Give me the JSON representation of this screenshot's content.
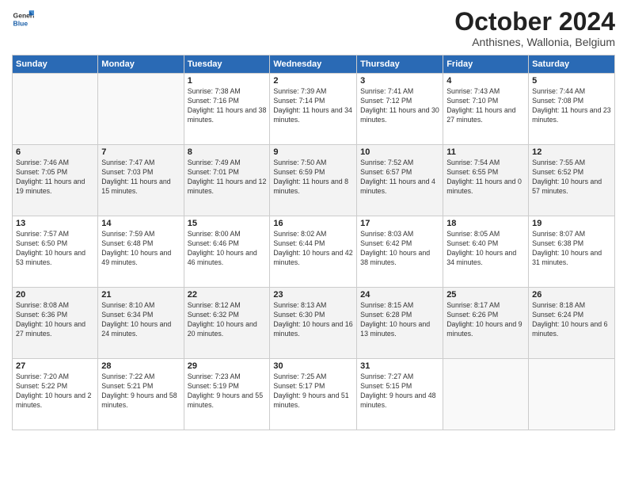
{
  "header": {
    "logo_general": "General",
    "logo_blue": "Blue",
    "month_title": "October 2024",
    "location": "Anthisnes, Wallonia, Belgium"
  },
  "days_of_week": [
    "Sunday",
    "Monday",
    "Tuesday",
    "Wednesday",
    "Thursday",
    "Friday",
    "Saturday"
  ],
  "weeks": [
    [
      {
        "day": "",
        "info": ""
      },
      {
        "day": "",
        "info": ""
      },
      {
        "day": "1",
        "info": "Sunrise: 7:38 AM\nSunset: 7:16 PM\nDaylight: 11 hours and 38 minutes."
      },
      {
        "day": "2",
        "info": "Sunrise: 7:39 AM\nSunset: 7:14 PM\nDaylight: 11 hours and 34 minutes."
      },
      {
        "day": "3",
        "info": "Sunrise: 7:41 AM\nSunset: 7:12 PM\nDaylight: 11 hours and 30 minutes."
      },
      {
        "day": "4",
        "info": "Sunrise: 7:43 AM\nSunset: 7:10 PM\nDaylight: 11 hours and 27 minutes."
      },
      {
        "day": "5",
        "info": "Sunrise: 7:44 AM\nSunset: 7:08 PM\nDaylight: 11 hours and 23 minutes."
      }
    ],
    [
      {
        "day": "6",
        "info": "Sunrise: 7:46 AM\nSunset: 7:05 PM\nDaylight: 11 hours and 19 minutes."
      },
      {
        "day": "7",
        "info": "Sunrise: 7:47 AM\nSunset: 7:03 PM\nDaylight: 11 hours and 15 minutes."
      },
      {
        "day": "8",
        "info": "Sunrise: 7:49 AM\nSunset: 7:01 PM\nDaylight: 11 hours and 12 minutes."
      },
      {
        "day": "9",
        "info": "Sunrise: 7:50 AM\nSunset: 6:59 PM\nDaylight: 11 hours and 8 minutes."
      },
      {
        "day": "10",
        "info": "Sunrise: 7:52 AM\nSunset: 6:57 PM\nDaylight: 11 hours and 4 minutes."
      },
      {
        "day": "11",
        "info": "Sunrise: 7:54 AM\nSunset: 6:55 PM\nDaylight: 11 hours and 0 minutes."
      },
      {
        "day": "12",
        "info": "Sunrise: 7:55 AM\nSunset: 6:52 PM\nDaylight: 10 hours and 57 minutes."
      }
    ],
    [
      {
        "day": "13",
        "info": "Sunrise: 7:57 AM\nSunset: 6:50 PM\nDaylight: 10 hours and 53 minutes."
      },
      {
        "day": "14",
        "info": "Sunrise: 7:59 AM\nSunset: 6:48 PM\nDaylight: 10 hours and 49 minutes."
      },
      {
        "day": "15",
        "info": "Sunrise: 8:00 AM\nSunset: 6:46 PM\nDaylight: 10 hours and 46 minutes."
      },
      {
        "day": "16",
        "info": "Sunrise: 8:02 AM\nSunset: 6:44 PM\nDaylight: 10 hours and 42 minutes."
      },
      {
        "day": "17",
        "info": "Sunrise: 8:03 AM\nSunset: 6:42 PM\nDaylight: 10 hours and 38 minutes."
      },
      {
        "day": "18",
        "info": "Sunrise: 8:05 AM\nSunset: 6:40 PM\nDaylight: 10 hours and 34 minutes."
      },
      {
        "day": "19",
        "info": "Sunrise: 8:07 AM\nSunset: 6:38 PM\nDaylight: 10 hours and 31 minutes."
      }
    ],
    [
      {
        "day": "20",
        "info": "Sunrise: 8:08 AM\nSunset: 6:36 PM\nDaylight: 10 hours and 27 minutes."
      },
      {
        "day": "21",
        "info": "Sunrise: 8:10 AM\nSunset: 6:34 PM\nDaylight: 10 hours and 24 minutes."
      },
      {
        "day": "22",
        "info": "Sunrise: 8:12 AM\nSunset: 6:32 PM\nDaylight: 10 hours and 20 minutes."
      },
      {
        "day": "23",
        "info": "Sunrise: 8:13 AM\nSunset: 6:30 PM\nDaylight: 10 hours and 16 minutes."
      },
      {
        "day": "24",
        "info": "Sunrise: 8:15 AM\nSunset: 6:28 PM\nDaylight: 10 hours and 13 minutes."
      },
      {
        "day": "25",
        "info": "Sunrise: 8:17 AM\nSunset: 6:26 PM\nDaylight: 10 hours and 9 minutes."
      },
      {
        "day": "26",
        "info": "Sunrise: 8:18 AM\nSunset: 6:24 PM\nDaylight: 10 hours and 6 minutes."
      }
    ],
    [
      {
        "day": "27",
        "info": "Sunrise: 7:20 AM\nSunset: 5:22 PM\nDaylight: 10 hours and 2 minutes."
      },
      {
        "day": "28",
        "info": "Sunrise: 7:22 AM\nSunset: 5:21 PM\nDaylight: 9 hours and 58 minutes."
      },
      {
        "day": "29",
        "info": "Sunrise: 7:23 AM\nSunset: 5:19 PM\nDaylight: 9 hours and 55 minutes."
      },
      {
        "day": "30",
        "info": "Sunrise: 7:25 AM\nSunset: 5:17 PM\nDaylight: 9 hours and 51 minutes."
      },
      {
        "day": "31",
        "info": "Sunrise: 7:27 AM\nSunset: 5:15 PM\nDaylight: 9 hours and 48 minutes."
      },
      {
        "day": "",
        "info": ""
      },
      {
        "day": "",
        "info": ""
      }
    ]
  ]
}
